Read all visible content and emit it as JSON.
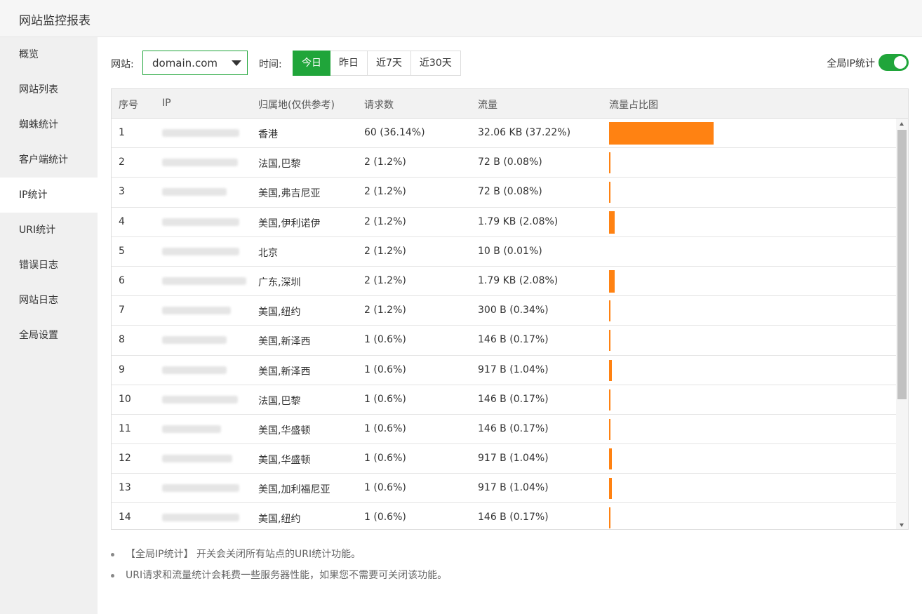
{
  "app": {
    "title": "网站监控报表"
  },
  "sidebar": {
    "items": [
      {
        "label": "概览"
      },
      {
        "label": "网站列表"
      },
      {
        "label": "蜘蛛统计"
      },
      {
        "label": "客户端统计"
      },
      {
        "label": "IP统计",
        "active": true
      },
      {
        "label": "URI统计"
      },
      {
        "label": "错误日志"
      },
      {
        "label": "网站日志"
      },
      {
        "label": "全局设置"
      }
    ]
  },
  "toolbar": {
    "site_label": "网站:",
    "site_value": "domain.com",
    "time_label": "时间:",
    "time_buttons": [
      {
        "label": "今日",
        "active": true
      },
      {
        "label": "昨日"
      },
      {
        "label": "近7天"
      },
      {
        "label": "近30天"
      }
    ],
    "global_ip_label": "全局IP统计",
    "global_ip_enabled": true
  },
  "table": {
    "headers": [
      "序号",
      "IP",
      "归属地(仅供参考)",
      "请求数",
      "流量",
      "流量占比图"
    ],
    "rows": [
      {
        "index": "1",
        "location": "香港",
        "requests": "60 (36.14%)",
        "traffic": "32.06 KB (37.22%)",
        "share": 37.22
      },
      {
        "index": "2",
        "location": "法国,巴黎",
        "requests": "2 (1.2%)",
        "traffic": "72 B (0.08%)",
        "share": 0.08
      },
      {
        "index": "3",
        "location": "美国,弗吉尼亚",
        "requests": "2 (1.2%)",
        "traffic": "72 B (0.08%)",
        "share": 0.08
      },
      {
        "index": "4",
        "location": "美国,伊利诺伊",
        "requests": "2 (1.2%)",
        "traffic": "1.79 KB (2.08%)",
        "share": 2.08
      },
      {
        "index": "5",
        "location": "北京",
        "requests": "2 (1.2%)",
        "traffic": "10 B (0.01%)",
        "share": 0.01
      },
      {
        "index": "6",
        "location": "广东,深圳",
        "requests": "2 (1.2%)",
        "traffic": "1.79 KB (2.08%)",
        "share": 2.08
      },
      {
        "index": "7",
        "location": "美国,纽约",
        "requests": "2 (1.2%)",
        "traffic": "300 B (0.34%)",
        "share": 0.34
      },
      {
        "index": "8",
        "location": "美国,新泽西",
        "requests": "1 (0.6%)",
        "traffic": "146 B (0.17%)",
        "share": 0.17
      },
      {
        "index": "9",
        "location": "美国,新泽西",
        "requests": "1 (0.6%)",
        "traffic": "917 B (1.04%)",
        "share": 1.04
      },
      {
        "index": "10",
        "location": "法国,巴黎",
        "requests": "1 (0.6%)",
        "traffic": "146 B (0.17%)",
        "share": 0.17
      },
      {
        "index": "11",
        "location": "美国,华盛顿",
        "requests": "1 (0.6%)",
        "traffic": "146 B (0.17%)",
        "share": 0.17
      },
      {
        "index": "12",
        "location": "美国,华盛顿",
        "requests": "1 (0.6%)",
        "traffic": "917 B (1.04%)",
        "share": 1.04
      },
      {
        "index": "13",
        "location": "美国,加利福尼亚",
        "requests": "1 (0.6%)",
        "traffic": "917 B (1.04%)",
        "share": 1.04
      },
      {
        "index": "14",
        "location": "美国,纽约",
        "requests": "1 (0.6%)",
        "traffic": "146 B (0.17%)",
        "share": 0.17
      }
    ]
  },
  "notes": [
    "【全局IP统计】 开关会关闭所有站点的URI统计功能。",
    "URI请求和流量统计会耗费一些服务器性能，如果您不需要可关闭该功能。"
  ],
  "colors": {
    "accent": "#20a53a",
    "bar": "#ff8212"
  }
}
